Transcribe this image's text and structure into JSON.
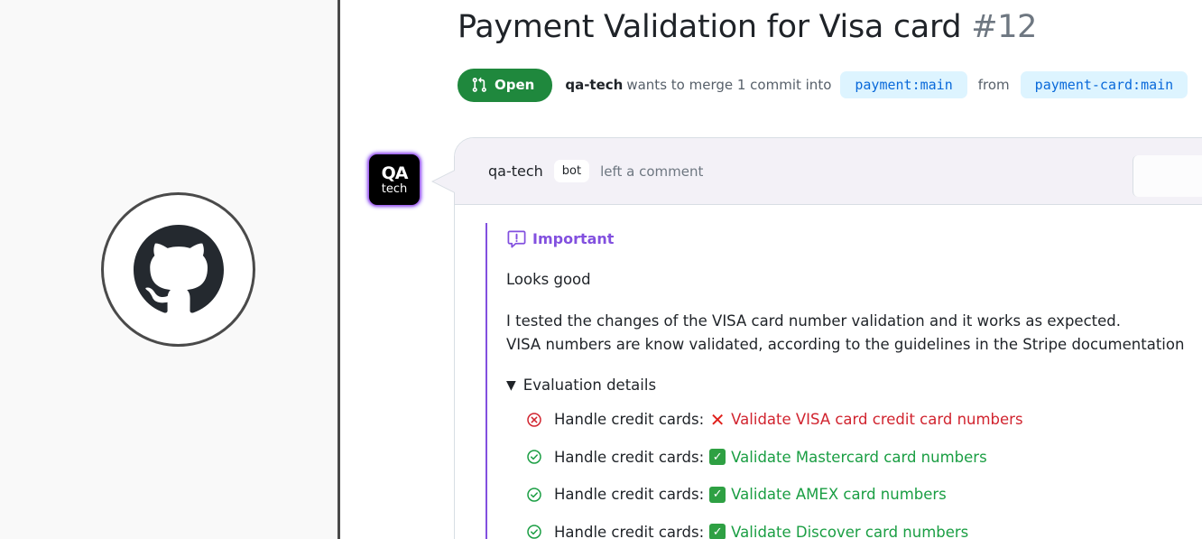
{
  "pr": {
    "title": "Payment Validation for Visa card",
    "number": "#12",
    "state": "Open",
    "author": "qa-tech",
    "merge_text": "wants to merge 1 commit into",
    "base_branch": "payment:main",
    "from_text": "from",
    "head_branch": "payment-card:main"
  },
  "avatar": {
    "line1": "QA",
    "line2": "tech"
  },
  "comment": {
    "author": "qa-tech",
    "badge": "bot",
    "action": "left a comment",
    "callout_label": "Important",
    "paragraph1": "Looks good",
    "paragraph2_line1": "I tested the changes of the VISA card number validation and it works as expected.",
    "paragraph2_line2": "VISA numbers are know validated, according to the guidelines in the Stripe documentation",
    "details_label": "Evaluation details",
    "checks": [
      {
        "status": "fail",
        "label": "Handle credit cards:",
        "result": "Validate VISA card credit card numbers"
      },
      {
        "status": "pass",
        "label": "Handle credit cards:",
        "result": "Validate Mastercard card numbers"
      },
      {
        "status": "pass",
        "label": "Handle credit cards:",
        "result": "Validate AMEX card numbers"
      },
      {
        "status": "pass",
        "label": "Handle credit cards:",
        "result": "Validate Discover card numbers"
      }
    ]
  },
  "colors": {
    "open_green": "#1f883d",
    "branch_bg": "#ddf4ff",
    "branch_text": "#0969da",
    "callout_purple": "#8250df",
    "fail_red": "#d1242f",
    "pass_green": "#1a9e43",
    "header_bg": "#f3f1f7"
  },
  "icons": {
    "left_logo": "github-icon",
    "state": "git-pull-request-icon",
    "callout": "report-icon",
    "fail": "x-circle-icon",
    "pass": "check-circle-icon"
  }
}
